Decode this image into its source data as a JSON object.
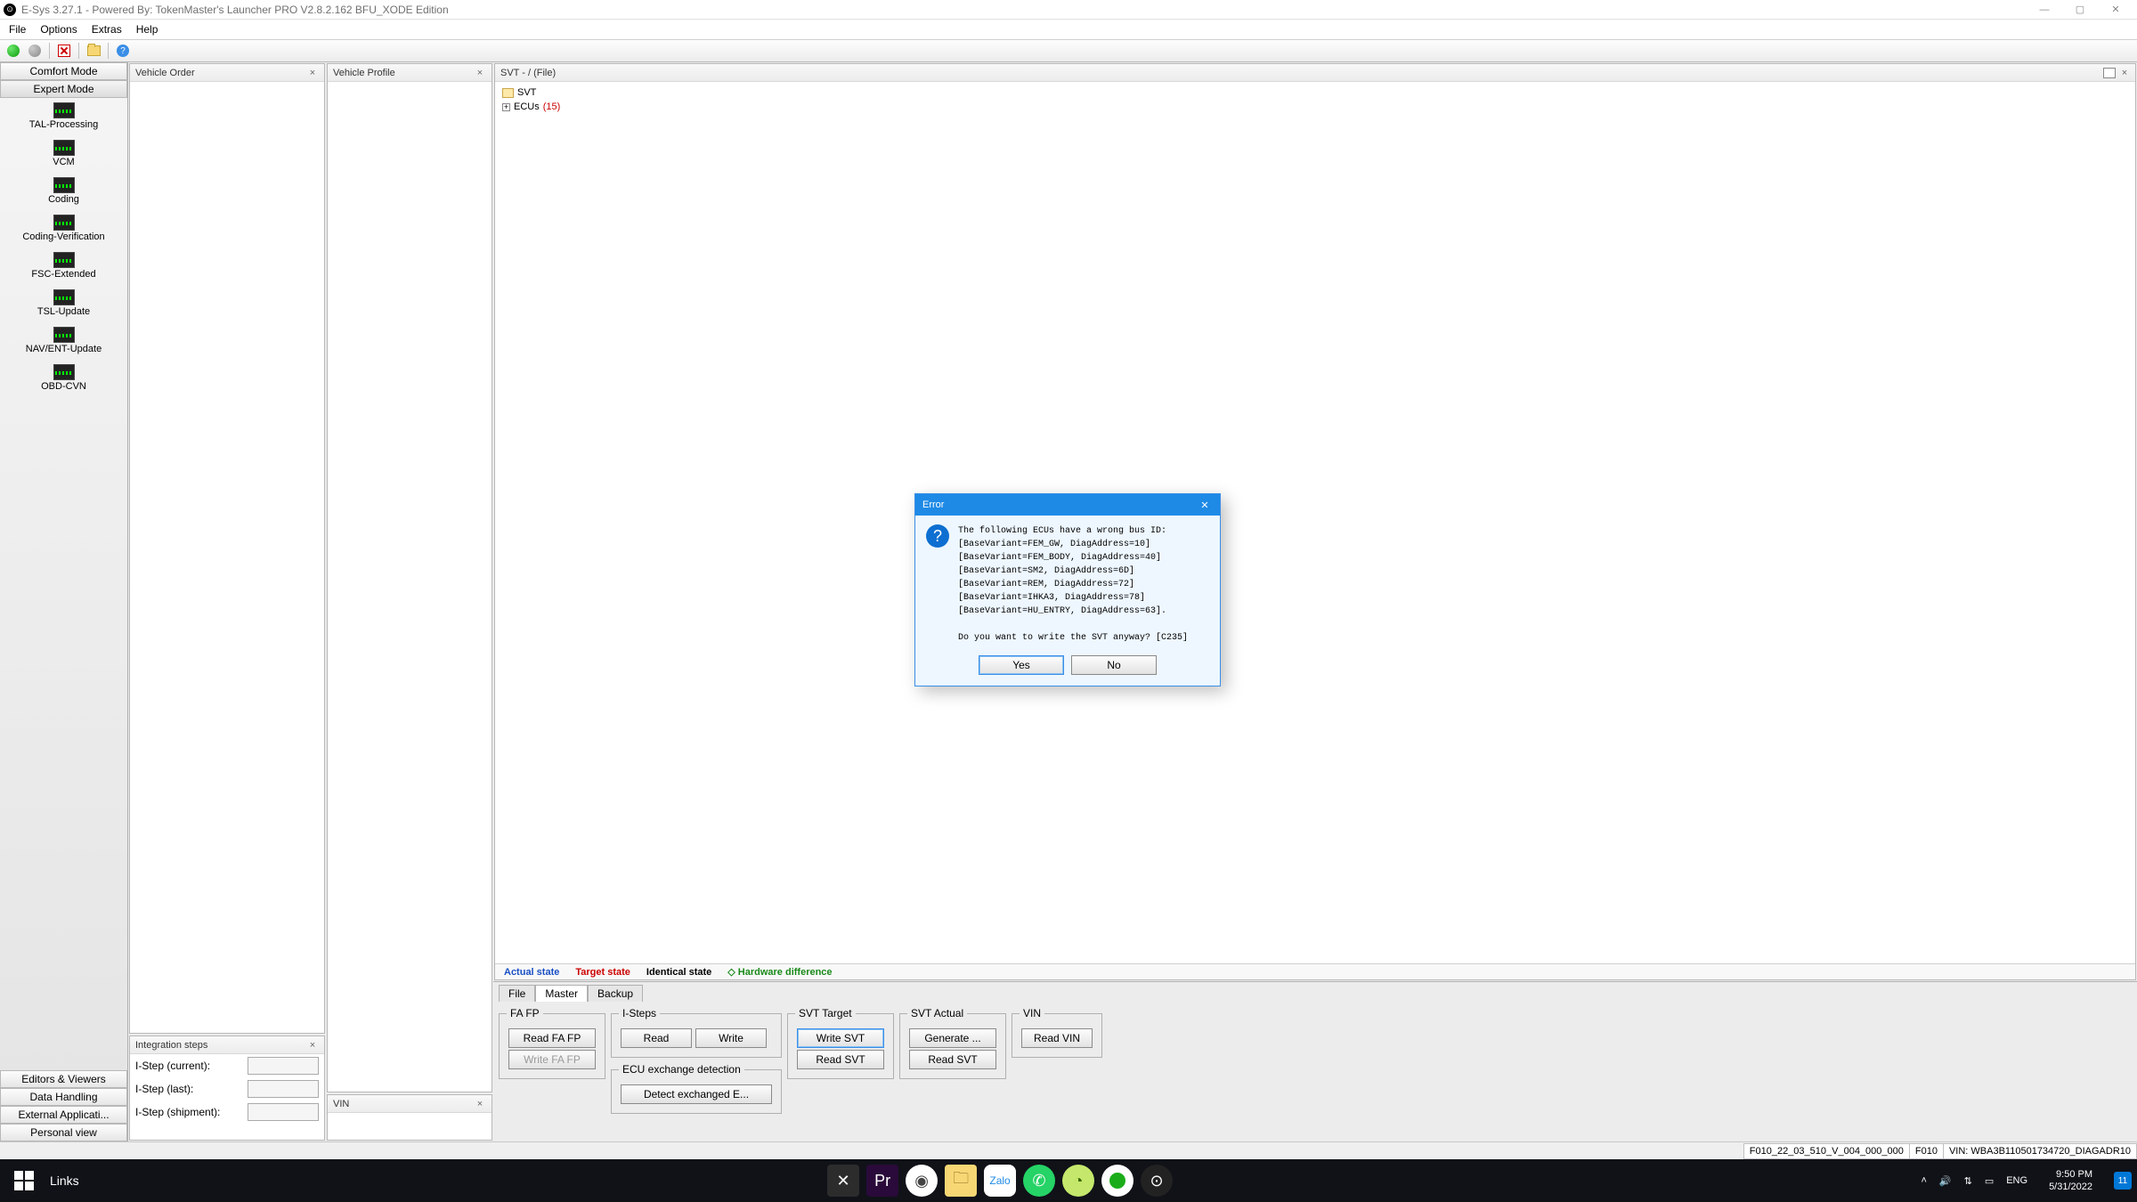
{
  "title": "E-Sys 3.27.1 - Powered By: TokenMaster's Launcher PRO V2.8.2.162 BFU_XODE Edition",
  "menu": {
    "file": "File",
    "options": "Options",
    "extras": "Extras",
    "help": "Help"
  },
  "sidebar": {
    "comfort": "Comfort Mode",
    "expert": "Expert Mode",
    "items": [
      {
        "label": "TAL-Processing"
      },
      {
        "label": "VCM"
      },
      {
        "label": "Coding"
      },
      {
        "label": "Coding-Verification"
      },
      {
        "label": "FSC-Extended"
      },
      {
        "label": "TSL-Update"
      },
      {
        "label": "NAV/ENT-Update"
      },
      {
        "label": "OBD-CVN"
      }
    ],
    "bottom": {
      "editors": "Editors & Viewers",
      "data": "Data Handling",
      "external": "External Applicati...",
      "personal": "Personal view"
    }
  },
  "panels": {
    "vehicleOrder": "Vehicle Order",
    "integrationSteps": "Integration steps",
    "istep_current_label": "I-Step (current):",
    "istep_last_label": "I-Step (last):",
    "istep_shipment_label": "I-Step (shipment):",
    "vehicleProfile": "Vehicle Profile",
    "vin": "VIN",
    "svtTitle": "SVT - / (File)",
    "svtRoot": "SVT",
    "svtEcusLabel": "ECUs ",
    "svtEcusCount": "(15)"
  },
  "legend": {
    "actual": "Actual state",
    "target": "Target state",
    "identical": "Identical state",
    "hardware": "Hardware difference"
  },
  "bottom_tabs": {
    "file": "File",
    "master": "Master",
    "backup": "Backup"
  },
  "groups": {
    "fafp": {
      "title": "FA FP",
      "readFaFp": "Read FA FP",
      "writeFaFp": "Write FA FP"
    },
    "isteps": {
      "title": "I-Steps",
      "read": "Read",
      "write": "Write"
    },
    "ecuExchange": {
      "title": "ECU exchange detection",
      "detect": "Detect exchanged E..."
    },
    "svtTarget": {
      "title": "SVT Target",
      "writeSvt": "Write SVT",
      "readSvt": "Read SVT"
    },
    "svtActual": {
      "title": "SVT Actual",
      "generate": "Generate ...",
      "readSvt": "Read SVT"
    },
    "vin": {
      "title": "VIN",
      "readVin": "Read VIN"
    }
  },
  "status": {
    "fcode": "F010_22_03_510_V_004_000_000",
    "series": "F010",
    "vin": "VIN: WBA3B110501734720_DIAGADR10"
  },
  "dialog": {
    "title": "Error",
    "body": "The following ECUs have a wrong bus ID:\n[BaseVariant=FEM_GW, DiagAddress=10]\n[BaseVariant=FEM_BODY, DiagAddress=40]\n[BaseVariant=SM2, DiagAddress=6D]\n[BaseVariant=REM, DiagAddress=72]\n[BaseVariant=IHKA3, DiagAddress=78]\n[BaseVariant=HU_ENTRY, DiagAddress=63].\n\nDo you want to write the SVT anyway? [C235]",
    "yes": "Yes",
    "no": "No"
  },
  "taskbar": {
    "search": "Links",
    "lang": "ENG",
    "time": "9:50 PM",
    "date": "5/31/2022",
    "badge": "11"
  }
}
